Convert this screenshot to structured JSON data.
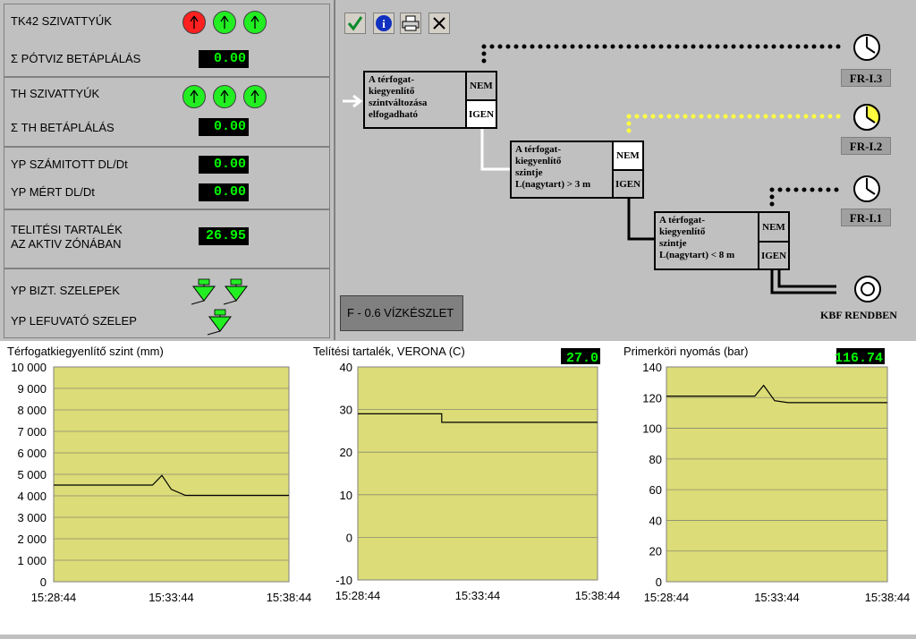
{
  "left": {
    "tk42_label": "TK42 SZIVATTYÚK",
    "potviz_label": "Σ PÓTVIZ BETÁPLÁLÁS",
    "potviz_value": "0.00",
    "th_label": "TH SZIVATTYÚK",
    "th_bet_label": "Σ TH  BETÁPLÁLÁS",
    "th_bet_value": "0.00",
    "yp_szam_label": "YP SZÁMITOTT DL/Dt",
    "yp_szam_value": "0.00",
    "yp_mert_label": "YP MÉRT DL/Dt",
    "yp_mert_value": "0.00",
    "telitesi_line1": "TELITÉSI TARTALÉK",
    "telitesi_line2": "AZ AKTIV ZÓNÁBAN",
    "telitesi_value": "26.95",
    "yp_bizt_label": "YP BIZT. SZELEPEK",
    "yp_lef_label": "YP LEFUVATÓ SZELEP"
  },
  "colors": {
    "pump_red": "#ff2020",
    "pump_green": "#22ee22",
    "display_text": "#00ff00",
    "chart_bg": "#dcdc78",
    "dots_black": "#000000",
    "dots_yellow": "#ffff40"
  },
  "toolbar": {
    "icons": [
      "check-icon",
      "info-icon",
      "printer-icon",
      "close-icon"
    ]
  },
  "logic": {
    "box1": [
      "A térfogat-",
      "kiegyenlítő",
      "szintváltozása",
      "elfogadható"
    ],
    "box2": [
      "A térfogat-",
      "kiegyenlítő",
      "szintje",
      "L(nagytart) > 3 m"
    ],
    "box3": [
      "A térfogat-",
      "kiegyenlítő",
      "szintje",
      "L(nagytart) < 8 m"
    ],
    "nem": "NEM",
    "igen": "IGEN",
    "fr13": "FR-I.3",
    "fr12": "FR-I.2",
    "fr11": "FR-I.1",
    "kbf": "KBF RENDBEN",
    "f06": "F - 0.6  VÍZKÉSZLET"
  },
  "chart_data": [
    {
      "type": "line",
      "title": "Térfogatkiegyenlítő szint (mm)",
      "x": [
        "15:28:44",
        "15:33:44",
        "15:38:44"
      ],
      "ylim": [
        0,
        10000
      ],
      "yticks": [
        "10 000",
        "9 000",
        "8 000",
        "7 000",
        "6 000",
        "5 000",
        "4 000",
        "3 000",
        "2 000",
        "1 000",
        "0"
      ],
      "series": [
        {
          "values": [
            [
              0,
              4500
            ],
            [
              0.42,
              4500
            ],
            [
              0.46,
              4950
            ],
            [
              0.5,
              4300
            ],
            [
              0.56,
              4020
            ],
            [
              1,
              4020
            ]
          ]
        }
      ]
    },
    {
      "type": "line",
      "title": "Telítési tartalék, VERONA (C)",
      "value": "27.0",
      "x": [
        "15:28:44",
        "15:33:44",
        "15:38:44"
      ],
      "ylim": [
        -10,
        40
      ],
      "yticks": [
        "40",
        "30",
        "20",
        "10",
        "0",
        "-10"
      ],
      "series": [
        {
          "values": [
            [
              0,
              29
            ],
            [
              0.35,
              29
            ],
            [
              0.35,
              27
            ],
            [
              1,
              27
            ]
          ]
        }
      ]
    },
    {
      "type": "line",
      "title": "Primerköri nyomás (bar)",
      "value": "116.74",
      "x": [
        "15:28:44",
        "15:33:44",
        "15:38:44"
      ],
      "ylim": [
        0,
        140
      ],
      "yticks": [
        "140",
        "120",
        "100",
        "80",
        "60",
        "40",
        "20",
        "0"
      ],
      "series": [
        {
          "values": [
            [
              0,
              121
            ],
            [
              0.4,
              121
            ],
            [
              0.44,
              128
            ],
            [
              0.49,
              118
            ],
            [
              0.55,
              116.7
            ],
            [
              1,
              116.7
            ]
          ]
        }
      ]
    }
  ]
}
